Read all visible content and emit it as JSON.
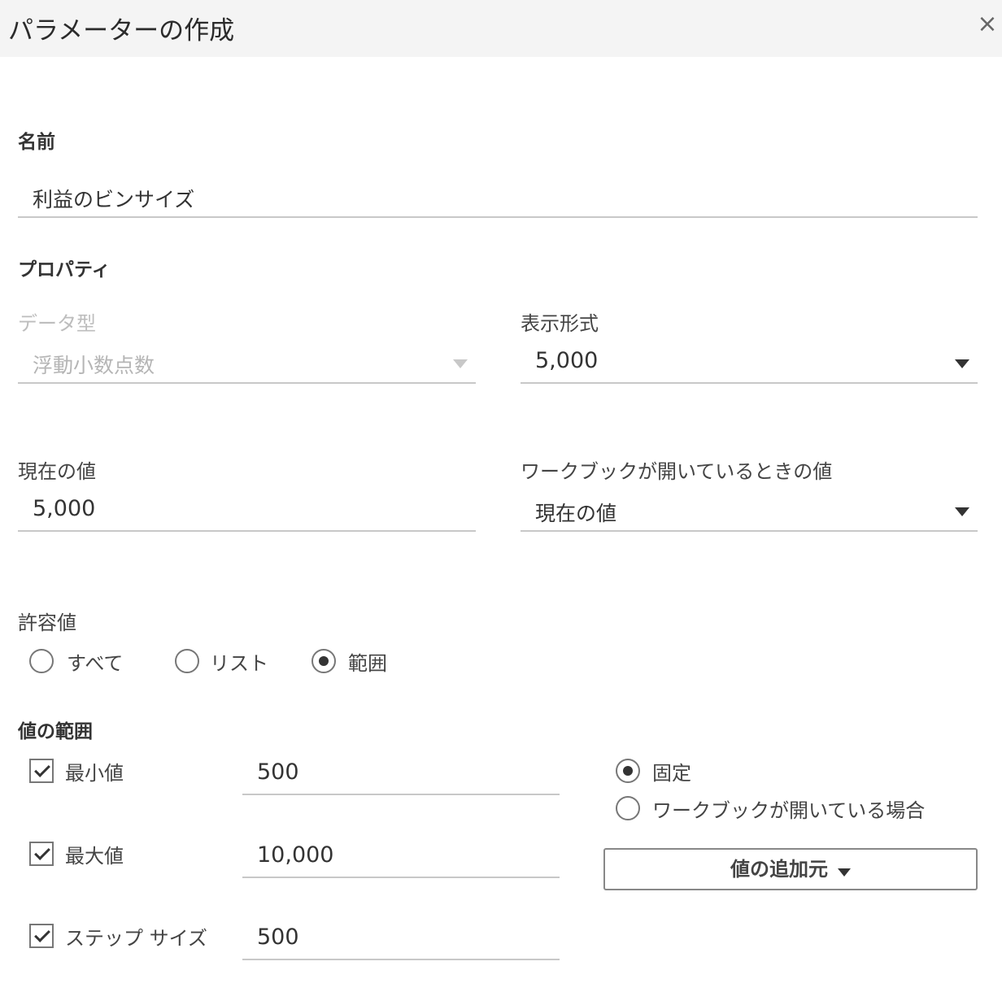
{
  "dialog": {
    "title": "パラメーターの作成",
    "close_glyph": "×"
  },
  "name_section": {
    "label": "名前",
    "value": "利益のビンサイズ"
  },
  "properties": {
    "label": "プロパティ",
    "data_type": {
      "label": "データ型",
      "value": "浮動小数点数",
      "enabled": false
    },
    "display_format": {
      "label": "表示形式",
      "value": "5,000"
    },
    "current_value": {
      "label": "現在の値",
      "value": "5,000"
    },
    "workbook_open_value": {
      "label": "ワークブックが開いているときの値",
      "value": "現在の値"
    }
  },
  "allowed_values": {
    "label": "許容値",
    "options": [
      {
        "label": "すべて",
        "selected": false
      },
      {
        "label": "リスト",
        "selected": false
      },
      {
        "label": "範囲",
        "selected": true
      }
    ]
  },
  "range": {
    "label": "値の範囲",
    "min": {
      "label": "最小値",
      "checked": true,
      "value": "500"
    },
    "max": {
      "label": "最大値",
      "checked": true,
      "value": "10,000"
    },
    "step": {
      "label": "ステップ サイズ",
      "checked": true,
      "value": "500"
    },
    "source_options": [
      {
        "label": "固定",
        "selected": true
      },
      {
        "label": "ワークブックが開いている場合",
        "selected": false
      }
    ],
    "add_from_button": "値の追加元"
  }
}
